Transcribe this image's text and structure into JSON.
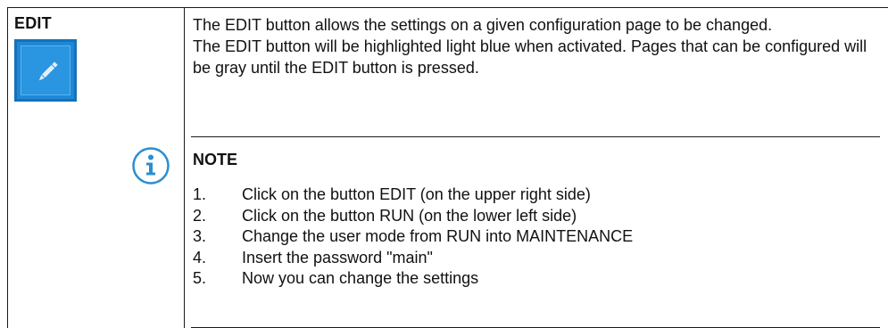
{
  "term": "EDIT",
  "icons": {
    "edit": "pencil-icon",
    "note": "info-icon"
  },
  "colors": {
    "edit_button": "#1e88d6",
    "info_icon": "#2a8fd0"
  },
  "description": {
    "para1": "The EDIT button allows the settings on a given configuration page to be changed.",
    "para2": "The EDIT button will be highlighted light blue when activated. Pages that can be configured will be gray until the EDIT button is pressed."
  },
  "note": {
    "title": "NOTE",
    "steps": [
      {
        "num": "1.",
        "text": "Click on the button EDIT (on the upper right side)"
      },
      {
        "num": "2.",
        "text": "Click on the button RUN (on the lower left side)"
      },
      {
        "num": "3.",
        "text": "Change the user mode from RUN into MAINTENANCE"
      },
      {
        "num": "4.",
        "text": "Insert the password \"main\""
      },
      {
        "num": "5.",
        "text": "Now you can change the settings"
      }
    ]
  }
}
